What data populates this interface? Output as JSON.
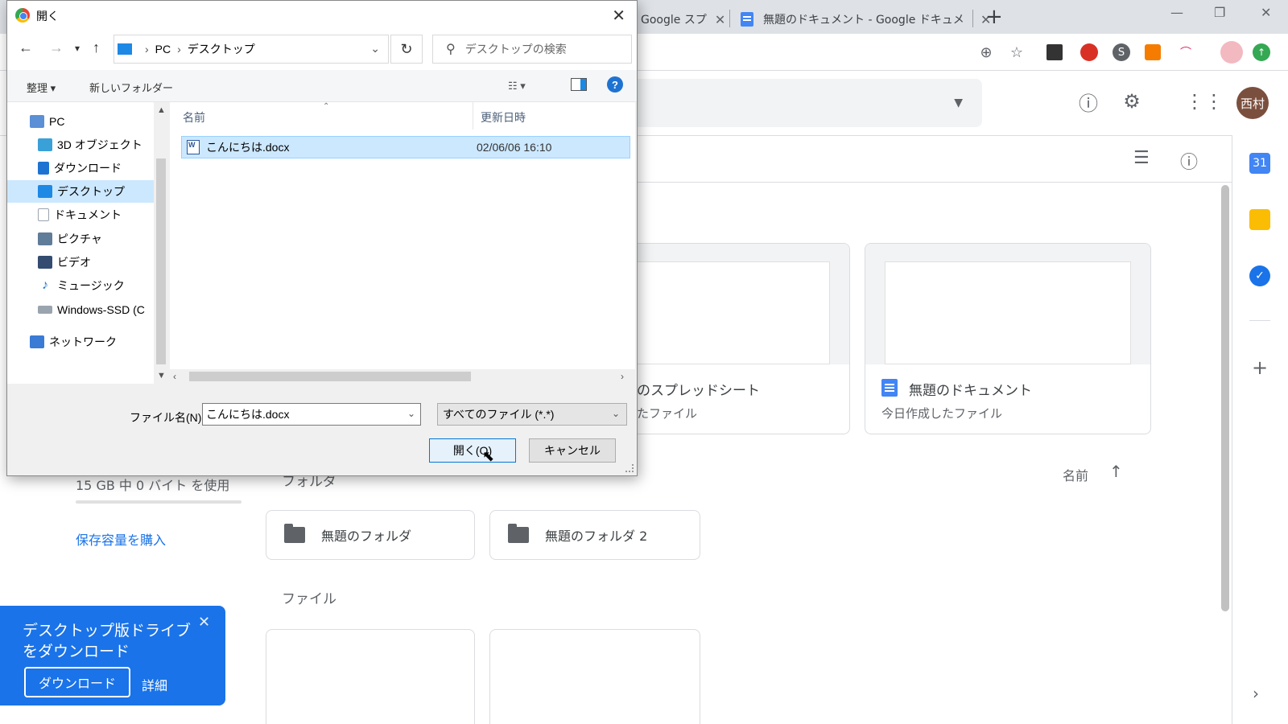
{
  "browser": {
    "tabs": [
      {
        "title": "Google スプ",
        "close": "✕"
      },
      {
        "title": "無題のドキュメント - Google ドキュメ",
        "close": "✕"
      }
    ],
    "new_tab": "+",
    "window_controls": {
      "minimize": "—",
      "restore": "❐",
      "close": "✕"
    }
  },
  "drive": {
    "avatar_initials": "西村",
    "suggested_cards": [
      {
        "title": "のスプレッドシート",
        "subtitle": "たファイル"
      },
      {
        "title": "無題のドキュメント",
        "subtitle": "今日作成したファイル"
      }
    ],
    "folders_label": "フォルダ",
    "folders": [
      {
        "label": "無題のフォルダ"
      },
      {
        "label": "無題のフォルダ 2"
      }
    ],
    "files_label": "ファイル",
    "sort": {
      "label": "名前",
      "arrow": "↑"
    },
    "storage": {
      "text": "15 GB 中 0 バイト を使用",
      "buy_link": "保存容量を購入"
    },
    "promo": {
      "text": "デスクトップ版ドライブをダウンロード",
      "button": "ダウンロード",
      "more": "詳細",
      "close": "✕"
    },
    "side_panel": {
      "calendar_day": "31"
    }
  },
  "dialog": {
    "title": "開く",
    "close": "✕",
    "address": {
      "root": "PC",
      "folder": "デスクトップ"
    },
    "search_placeholder": "デスクトップの検索",
    "commands": {
      "organize": "整理 ▾",
      "new_folder": "新しいフォルダー",
      "help": "?"
    },
    "nav_items": [
      {
        "label": "PC",
        "icon": "pc-icon",
        "color": "#5b8fd6"
      },
      {
        "label": "3D オブジェクト",
        "icon": "cube-icon",
        "color": "#3aa0d8"
      },
      {
        "label": "ダウンロード",
        "icon": "download-icon",
        "color": "#1e73d2"
      },
      {
        "label": "デスクトップ",
        "icon": "desktop-icon",
        "color": "#1e88e5",
        "selected": true
      },
      {
        "label": "ドキュメント",
        "icon": "document-icon",
        "color": "#9aa4ae"
      },
      {
        "label": "ピクチャ",
        "icon": "picture-icon",
        "color": "#5f7c99"
      },
      {
        "label": "ビデオ",
        "icon": "video-icon",
        "color": "#334c70"
      },
      {
        "label": "ミュージック",
        "icon": "music-icon",
        "color": "#1e73d2"
      },
      {
        "label": "Windows-SSD (C",
        "icon": "drive-icon",
        "color": "#9aa4ae"
      },
      {
        "label": "ネットワーク",
        "icon": "network-icon",
        "color": "#3a7bd5"
      }
    ],
    "columns": {
      "name": "名前",
      "modified": "更新日時"
    },
    "files": [
      {
        "name": "こんにちは.docx",
        "modified": "02/06/06 16:10"
      }
    ],
    "filename_label": "ファイル名(N):",
    "filename_value": "こんにちは.docx",
    "file_type": "すべてのファイル (*.*)",
    "open_button": "開く(O)",
    "cancel_button": "キャンセル"
  }
}
